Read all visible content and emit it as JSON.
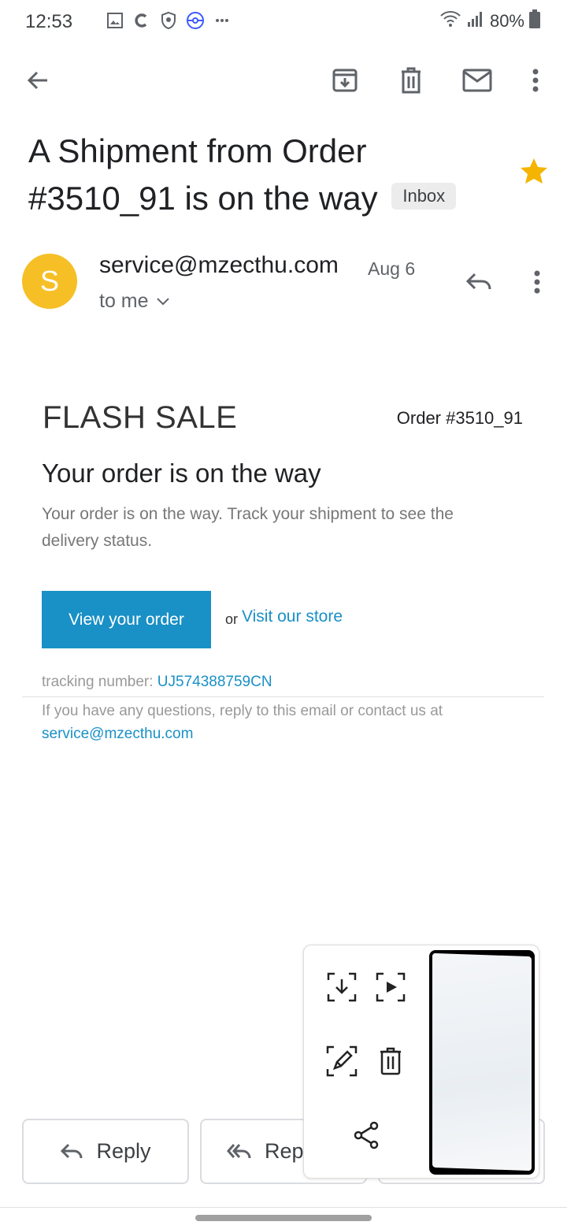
{
  "status_bar": {
    "time": "12:53",
    "battery": "80%",
    "icons": [
      "gallery-icon",
      "c-app-icon",
      "shield-icon",
      "pokeball-icon",
      "more-dots-icon",
      "wifi-icon",
      "signal-icon",
      "battery-icon"
    ]
  },
  "toolbar": {
    "back": "back-arrow-icon",
    "archive": "archive-icon",
    "delete": "trash-icon",
    "mark_unread": "mail-icon",
    "more": "more-vert-icon"
  },
  "email": {
    "subject": "A Shipment from Order #3510_91 is on the way",
    "label": "Inbox",
    "starred": true,
    "star_color": "#f4b400",
    "sender": {
      "initial": "S",
      "address": "service@mzecthu.com",
      "date": "Aug 6",
      "recipient": "to me",
      "avatar_color": "#f6bf26"
    },
    "body": {
      "brand": "FLASH SALE",
      "order_number": "Order #3510_91",
      "headline": "Your order is on the way",
      "description": "Your order is on the way. Track your shipment to see the delivery status.",
      "cta_label": "View your order",
      "cta_color": "#1990c6",
      "or_text": "or",
      "store_link": "Visit our store",
      "tracking_label": "tracking number:",
      "tracking_number": "UJ574388759CN",
      "footer_text": "If you have any questions, reply to this email or contact us at",
      "footer_email": "service@mzecthu.com"
    }
  },
  "actions": {
    "reply": "Reply",
    "reply_all": "Repl"
  },
  "capture_toolbar": {
    "buttons": [
      "scroll-capture-icon",
      "record-icon",
      "edit-icon",
      "delete-icon",
      "share-icon"
    ]
  }
}
